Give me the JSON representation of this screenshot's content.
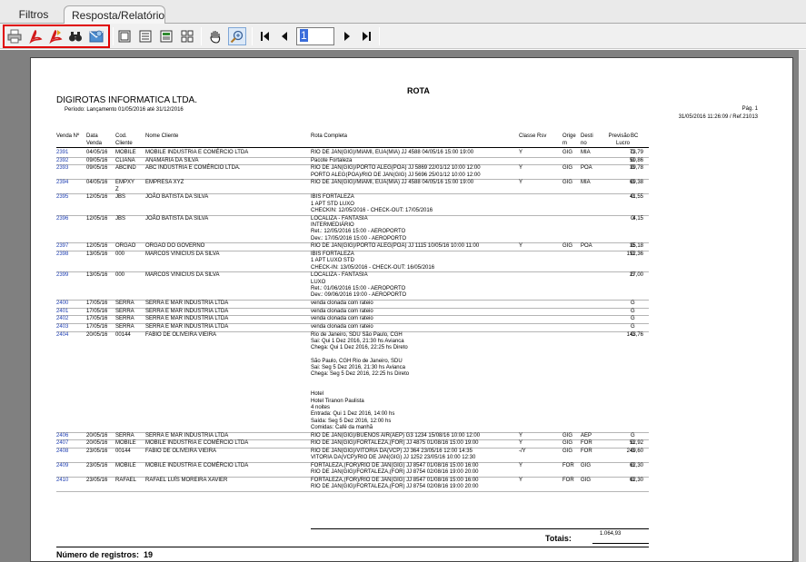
{
  "tabs": [
    {
      "label": "Filtros"
    },
    {
      "label": "Resposta/Relatório"
    }
  ],
  "toolbar": {
    "page_value": "1",
    "icons": [
      "print-icon",
      "pdf-icon",
      "pdf-export-icon",
      "binoculars-icon",
      "email-icon",
      "single-page-icon",
      "page-width-icon",
      "two-pages-icon",
      "four-pages-icon",
      "hand-icon",
      "zoom-icon",
      "first-page-icon",
      "prev-page-icon",
      "next-page-icon",
      "last-page-icon"
    ]
  },
  "report": {
    "title": "ROTA",
    "company": "DIGIROTAS INFORMATICA LTDA.",
    "period": "Período: Lançamento 01/05/2016 até 31/12/2016",
    "page": "Pág. 1",
    "printed_at": "31/05/2016 11:26:09 / Ref.21013",
    "headers": {
      "venda": "Venda Nº",
      "data": "Data\nVenda",
      "cod": "Cod.\nCliente",
      "nome": "Nome Cliente",
      "rota": "Rota Completa",
      "classe": "Classe Rsv",
      "orig": "Orige\nm",
      "dest": "Desti\nno",
      "prev": "Previsão\nLucro",
      "bc": "BC"
    },
    "rows": [
      {
        "venda": "2391",
        "data": "04/05/16",
        "cod": "MOBILE",
        "nome": "MOBILE INDUSTRIA E COMÉRCIO LTDA",
        "rota": [
          "RIO DE JAN(GIG)/MIAMI, EUA(MIA) JJ 4588 04/05/16 15:00 19:00"
        ],
        "classe": "Y",
        "orig": "GIG",
        "dest": "MIA",
        "prev": "73,79",
        "bc": "G"
      },
      {
        "venda": "2392",
        "data": "09/05/16",
        "cod": "CLIANA",
        "nome": "ANAMARIA DA SILVA",
        "rota": [
          "Pacote Fortaleza"
        ],
        "classe": "",
        "orig": "",
        "dest": "",
        "prev": "50,86",
        "bc": "G"
      },
      {
        "venda": "2393",
        "data": "09/05/16",
        "cod": "ABCIND",
        "nome": "ABC INDUSTRIA E COMÉRCIO LTDA.",
        "rota": [
          "RIO DE JAN(GIG)/PORTO ALEG(POA) JJ 5869 22/01/12 10:00 12:00",
          "PORTO ALEG(POA)/RIO DE JAN(GIG) JJ 5696 25/01/12 10:00 12:00"
        ],
        "classe": "Y",
        "orig": "GIG",
        "dest": "POA",
        "prev": "39,78",
        "bc": "G"
      },
      {
        "venda": "2394",
        "data": "04/05/16",
        "cod": "EMPXY\nZ",
        "nome": "EMPRESA XYZ",
        "rota": [
          "RIO DE JAN(GIG)/MIAMI, EUA(MIA) JJ 4588 04/05/16 15:00 19:00"
        ],
        "classe": "Y",
        "orig": "GIG",
        "dest": "MIA",
        "prev": "69,38",
        "bc": "G"
      },
      {
        "venda": "2395",
        "data": "12/05/16",
        "cod": "JBS",
        "nome": "JOÃO BATISTA DA SILVA",
        "rota": [
          "IBIS FORTALEZA",
          "1 APT STD LUXO",
          "CHECKIN: 12/05/2016 - CHECK-OUT: 17/05/2016"
        ],
        "classe": "",
        "orig": "",
        "dest": "",
        "prev": "41,55",
        "bc": "G"
      },
      {
        "venda": "2396",
        "data": "12/05/16",
        "cod": "JBS",
        "nome": "JOÃO BATISTA DA SILVA",
        "rota": [
          "LOCALIZA - FANTASIA",
          "INTERMEDIÁRIO",
          "Ret.: 12/05/2016 15:00 - AEROPORTO",
          "Dev.: 17/05/2016 15:00 - AEROPORTO"
        ],
        "classe": "",
        "orig": "",
        "dest": "",
        "prev": "4,15",
        "bc": "G"
      },
      {
        "venda": "2397",
        "data": "12/05/16",
        "cod": "ORGAO",
        "nome": "ORGAO DO GOVERNO",
        "rota": [
          "RIO DE JAN(GIG)/PORTO ALEG(POA) JJ 1115 10/05/16 10:00 11:00"
        ],
        "classe": "Y",
        "orig": "GIG",
        "dest": "POA",
        "prev": "35,18",
        "bc": "G"
      },
      {
        "venda": "2398",
        "data": "13/05/16",
        "cod": "000",
        "nome": "MARCOS VINICIUS DA SILVA",
        "rota": [
          "IBIS FORTALEZA",
          "1 APT LUXO STD",
          "CHECK-IN: 13/05/2016 - CHECK-OUT: 16/05/2016"
        ],
        "classe": "",
        "orig": "",
        "dest": "",
        "prev": "152,36",
        "bc": "G"
      },
      {
        "venda": "2399",
        "data": "13/05/16",
        "cod": "000",
        "nome": "MARCOS VINICIUS DA SILVA",
        "rota": [
          "LOCALIZA - FANTASIA",
          "LUXO",
          "Ret.: 01/06/2016 15:00 - AEROPORTO",
          "Dev.: 09/06/2016 19:00 - AEROPORTO"
        ],
        "classe": "",
        "orig": "",
        "dest": "",
        "prev": "27,00",
        "bc": "G"
      },
      {
        "venda": "2400",
        "data": "17/05/16",
        "cod": "SERRA",
        "nome": "SERRA E MAR INDUSTRIA LTDA",
        "rota": [
          "venda clonada com rateio"
        ],
        "classe": "",
        "orig": "",
        "dest": "",
        "prev": "",
        "bc": "G"
      },
      {
        "venda": "2401",
        "data": "17/05/16",
        "cod": "SERRA",
        "nome": "SERRA E MAR INDUSTRIA LTDA",
        "rota": [
          "venda clonada com rateio"
        ],
        "classe": "",
        "orig": "",
        "dest": "",
        "prev": "",
        "bc": "G"
      },
      {
        "venda": "2402",
        "data": "17/05/16",
        "cod": "SERRA",
        "nome": "SERRA E MAR INDUSTRIA LTDA",
        "rota": [
          "venda clonada com rateio"
        ],
        "classe": "",
        "orig": "",
        "dest": "",
        "prev": "",
        "bc": "G"
      },
      {
        "venda": "2403",
        "data": "17/05/16",
        "cod": "SERRA",
        "nome": "SERRA E MAR INDUSTRIA LTDA",
        "rota": [
          "venda clonada com rateio"
        ],
        "classe": "",
        "orig": "",
        "dest": "",
        "prev": "",
        "bc": "G"
      },
      {
        "venda": "2404",
        "data": "20/05/16",
        "cod": "00144",
        "nome": "FABIO DE OLIVEIRA VIEIRA",
        "rota": [
          "Rio de Janeiro, SDU  São Paulo, CGH",
          "Sai: Qui 1 Dez 2016, 21:30 hs Avianca",
          "Chega: Qui 1 Dez 2016, 22:25 hs Direto",
          "",
          "São Paulo, CGH  Rio de Janeiro, SDU",
          "Sai: Seg 5 Dez 2016, 21:30 hs Avianca",
          "Chega: Seg 5 Dez 2016, 22:25 hs Direto",
          "",
          "",
          "Hotel",
          "Hotel Tiranon Paulista",
          "4 noites",
          "Entrada: Qui 1 Dez 2016, 14:00 hs",
          "Saída: Seg 5 Dez 2016, 12:00 hs",
          "Comidas: Café da manhã"
        ],
        "classe": "",
        "orig": "",
        "dest": "",
        "prev": "143,76",
        "bc": "G"
      },
      {
        "venda": "2406",
        "data": "20/05/16",
        "cod": "SERRA",
        "nome": "SERRA E MAR INDUSTRIA LTDA",
        "rota": [
          "RIO DE JAN(GIG)/BUENOS AIR(AEP) G3 1234 15/08/16 10:00 12:00"
        ],
        "classe": "Y",
        "orig": "GIG",
        "dest": "AEP",
        "prev": "",
        "bc": "G"
      },
      {
        "venda": "2407",
        "data": "20/05/16",
        "cod": "MOBILE",
        "nome": "MOBILE INDUSTRIA E COMÉRCIO LTDA",
        "rota": [
          "RIO DE JAN(GIG)/FORTALEZA,(FOR) JJ 4875 01/08/16 15:00 19:00"
        ],
        "classe": "Y",
        "orig": "GIG",
        "dest": "FOR",
        "prev": "52,92",
        "bc": "G"
      },
      {
        "venda": "2408",
        "data": "23/05/16",
        "cod": "00144",
        "nome": "FABIO DE OLIVEIRA VIEIRA",
        "rota": [
          "RIO DE JAN(GIG)/VITORIA DA(VCP) JJ  364 23/05/16 12:00 14:35",
          "VITORIA DA(VCP)/RIO DE JAN(GIG) JJ 1252 23/05/16 10:00 12:30"
        ],
        "classe": "-/Y",
        "orig": "GIG",
        "dest": "FOR",
        "prev": "249,60",
        "bc": "G"
      },
      {
        "venda": "2409",
        "data": "23/05/16",
        "cod": "MOBILE",
        "nome": "MOBILE INDUSTRIA E COMÉRCIO LTDA",
        "rota": [
          "FORTALEZA,(FOR)/RIO DE JAN(GIG) JJ 8547 01/08/16 15:00 16:00",
          "RIO DE JAN(GIG)/FORTALEZA,(FOR) JJ 8754 02/08/16 19:00 20:00"
        ],
        "classe": "Y",
        "orig": "FOR",
        "dest": "GIG",
        "prev": "62,30",
        "bc": "G"
      },
      {
        "venda": "2410",
        "data": "23/05/16",
        "cod": "RAFAEL",
        "nome": "RAFAEL LUÍS MOREIRA XAVIER",
        "rota": [
          "FORTALEZA,(FOR)/RIO DE JAN(GIG) JJ 8547 01/08/16 15:00 16:00",
          "RIO DE JAN(GIG)/FORTALEZA,(FOR) JJ 8754 02/08/16 19:00 20:00"
        ],
        "classe": "Y",
        "orig": "FOR",
        "dest": "GIG",
        "prev": "62,30",
        "bc": "G"
      }
    ],
    "totals_label": "Totais:",
    "totals_value": "1.064,93",
    "records_label": "Número de registros:",
    "records_value": "19"
  }
}
